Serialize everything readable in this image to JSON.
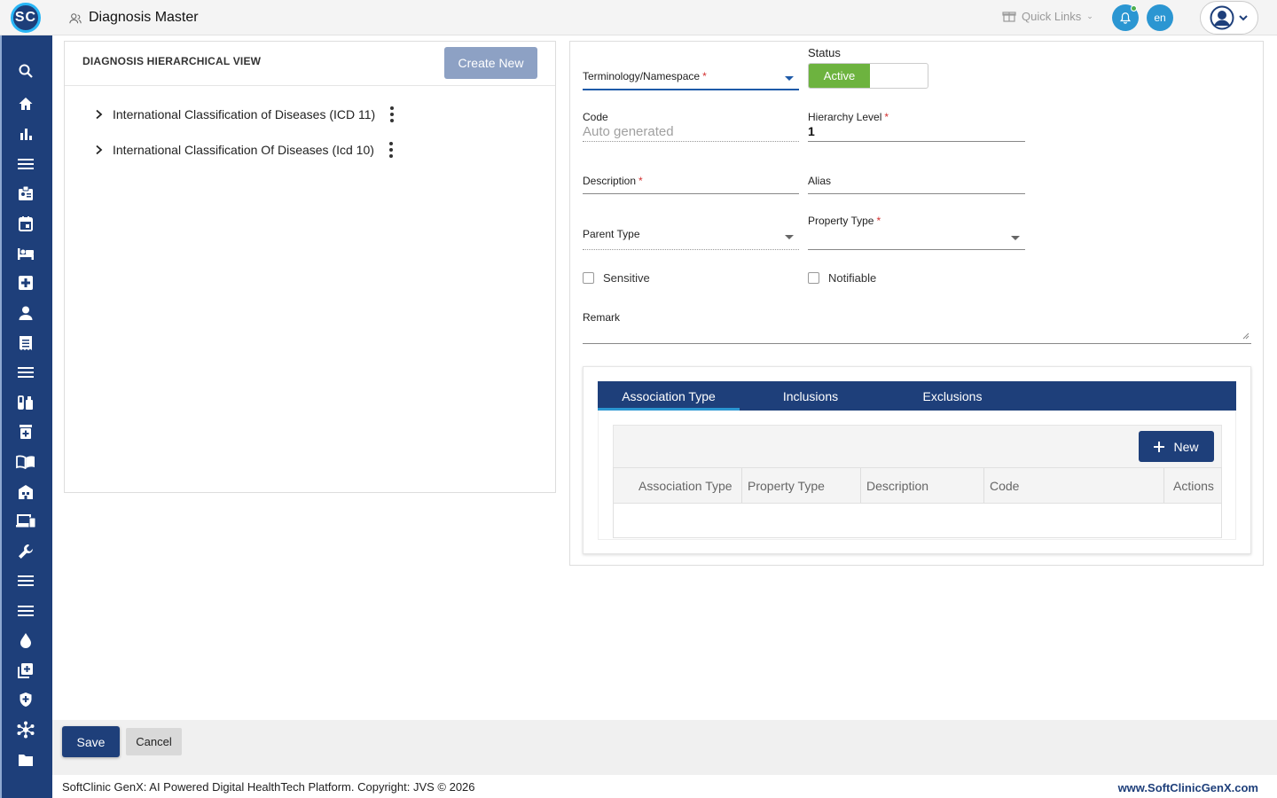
{
  "header": {
    "logo_text": "SC",
    "page_title": "Diagnosis Master",
    "quick_links": "Quick Links",
    "language": "en"
  },
  "sidebar": {
    "icons": [
      "search-icon",
      "home-icon",
      "chart-icon",
      "menu-icon",
      "badge-icon",
      "calendar-icon",
      "bed-icon",
      "medical-plus-icon",
      "person-icon",
      "receipt-icon",
      "list-icon",
      "lab-icon",
      "pharmacy-icon",
      "book-icon",
      "building-icon",
      "devices-icon",
      "wrench-icon",
      "menu-icon",
      "menu-icon",
      "drop-icon",
      "add-box-icon",
      "shield-icon",
      "hub-icon",
      "folder-icon"
    ]
  },
  "left_panel": {
    "title": "DIAGNOSIS HIERARCHICAL VIEW",
    "create_button": "Create New",
    "tree": [
      {
        "label": "International Classification of Diseases (ICD 11)"
      },
      {
        "label": "International Classification Of Diseases (Icd 10)"
      }
    ]
  },
  "form": {
    "terminology_label": "Terminology/Namespace",
    "status_label": "Status",
    "status_value": "Active",
    "code_label": "Code",
    "code_placeholder": "Auto generated",
    "hierarchy_label": "Hierarchy Level",
    "hierarchy_value": "1",
    "description_label": "Description",
    "alias_label": "Alias",
    "parent_type_label": "Parent Type",
    "property_type_label": "Property Type",
    "sensitive_label": "Sensitive",
    "notifiable_label": "Notifiable",
    "remark_label": "Remark"
  },
  "association": {
    "tabs": [
      "Association Type",
      "Inclusions",
      "Exclusions"
    ],
    "new_button": "New",
    "columns": [
      "Association Type",
      "Property Type",
      "Description",
      "Code",
      "Actions"
    ]
  },
  "actions": {
    "save": "Save",
    "cancel": "Cancel"
  },
  "footer": {
    "copyright": "SoftClinic GenX: AI Powered Digital HealthTech Platform. Copyright: JVS © 2026",
    "website": "www.SoftClinicGenX.com"
  },
  "colors": {
    "primary": "#1e3f7a",
    "accent": "#2b96d2",
    "active_green": "#6db33f",
    "required": "#d32f2f"
  }
}
